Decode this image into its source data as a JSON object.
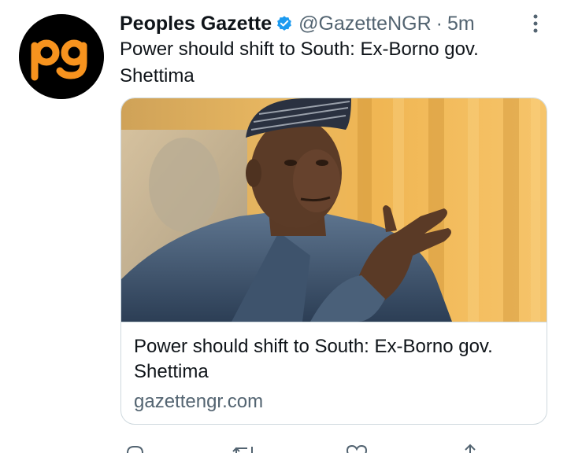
{
  "tweet": {
    "display_name": "Peoples Gazette",
    "handle": "@GazetteNGR",
    "separator": "·",
    "time": "5m",
    "text": "Power should shift to South: Ex-Borno gov. Shettima",
    "avatar_logo_text": "pg",
    "verified_icon": "verified-badge-icon",
    "more_icon": "more-vertical-icon"
  },
  "card": {
    "title": "Power should shift to South: Ex-Borno gov. Shettima",
    "domain": "gazettengr.com"
  },
  "actions": {
    "icons": [
      "reply-icon",
      "retweet-icon",
      "like-icon",
      "share-icon"
    ]
  },
  "colors": {
    "brand_orange": "#f7931e",
    "text_primary": "#0f1419",
    "text_secondary": "#536471",
    "verified_blue": "#1d9bf0",
    "border": "#cfd9de"
  }
}
